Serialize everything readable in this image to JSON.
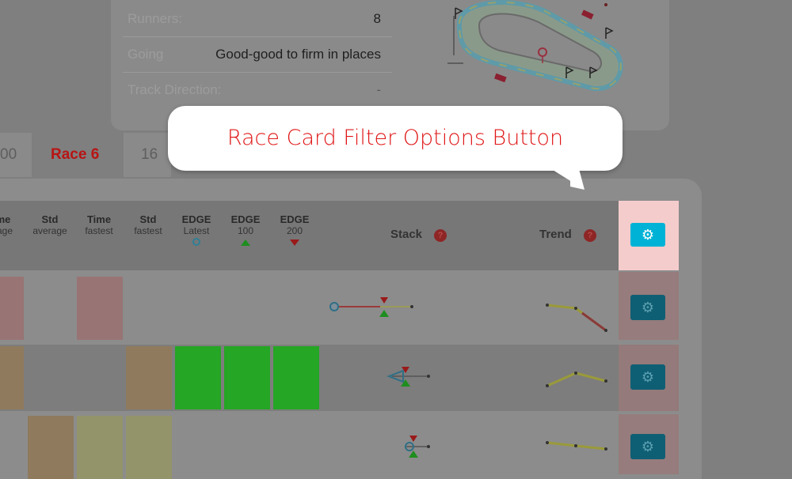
{
  "info": {
    "runners_label": "Runners:",
    "runners_value": "8",
    "going_label": "Going",
    "going_value": "Good-good to firm in places",
    "direction_label": "Track Direction:",
    "direction_value": "-"
  },
  "tabs": {
    "prev_fragment": "00",
    "race_label": "Race 6",
    "next_fragment": "16"
  },
  "columns": [
    {
      "title": "me",
      "sub": "rage"
    },
    {
      "title": "Std",
      "sub": "average"
    },
    {
      "title": "Time",
      "sub": "fastest"
    },
    {
      "title": "Std",
      "sub": "fastest"
    },
    {
      "title": "EDGE",
      "sub": "Latest"
    },
    {
      "title": "EDGE",
      "sub": "100"
    },
    {
      "title": "EDGE",
      "sub": "200"
    }
  ],
  "stack_label": "Stack",
  "trend_label": "Trend",
  "help_glyph": "?",
  "gear_glyph": "⚙",
  "callout": {
    "text": "Race Card Filter Options Button"
  },
  "colors": {
    "accent": "#00b3d6",
    "callout_text": "#e01717",
    "race_tab": "#b81414",
    "edge_green": "#25a625"
  },
  "icons": {
    "filter_options": "gear-icon",
    "help": "question-circle-icon",
    "latest_marker": "circle-icon",
    "up_marker": "triangle-up-icon",
    "down_marker": "triangle-down-icon"
  }
}
